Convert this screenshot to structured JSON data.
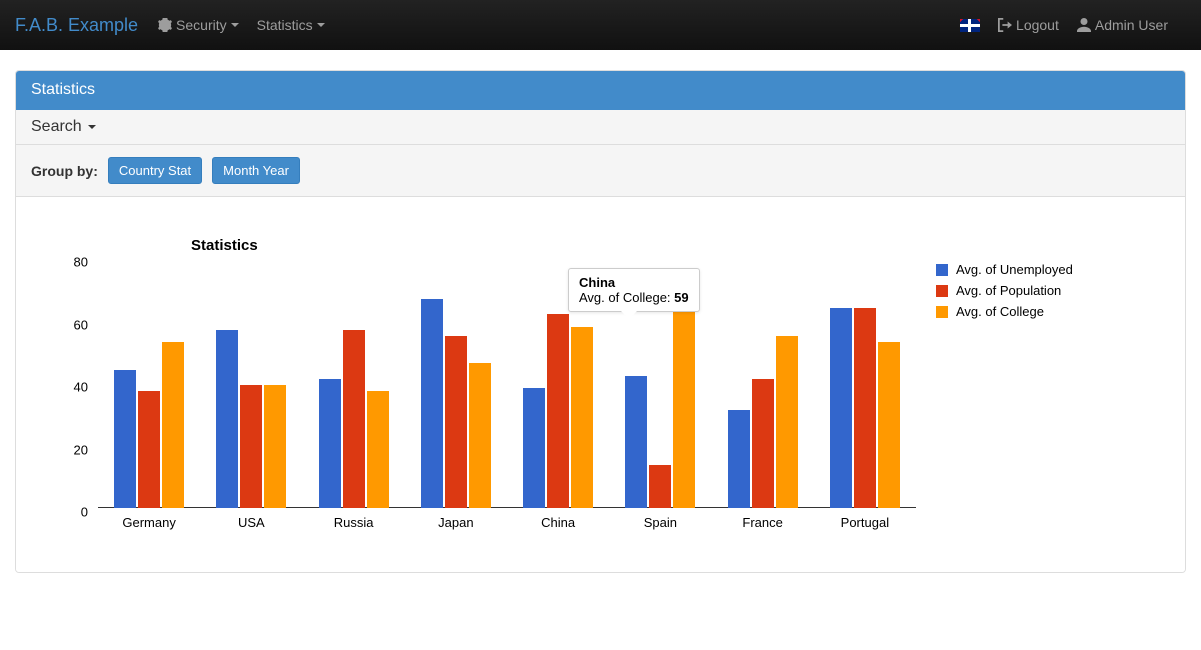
{
  "navbar": {
    "brand": "F.A.B. Example",
    "security": "Security",
    "statistics": "Statistics",
    "logout": "Logout",
    "user": "Admin User"
  },
  "panel": {
    "title": "Statistics",
    "search_label": "Search",
    "groupby_label": "Group by:",
    "group_buttons": [
      "Country Stat",
      "Month Year"
    ]
  },
  "tooltip": {
    "category": "China",
    "series_label": "Avg. of College:",
    "value": "59"
  },
  "chart_data": {
    "type": "bar",
    "title": "Statistics",
    "ylabel": "",
    "xlabel": "",
    "ylim": [
      0,
      80
    ],
    "yticks": [
      0,
      20,
      40,
      60,
      80
    ],
    "categories": [
      "Germany",
      "USA",
      "Russia",
      "Japan",
      "China",
      "Spain",
      "France",
      "Portugal"
    ],
    "series": [
      {
        "name": "Avg. of Unemployed",
        "color": "#3366cc",
        "values": [
          45,
          58,
          42,
          68,
          39,
          43,
          32,
          65
        ]
      },
      {
        "name": "Avg. of Population",
        "color": "#dc3912",
        "values": [
          38,
          40,
          58,
          56,
          63,
          14,
          42,
          65
        ]
      },
      {
        "name": "Avg. of College",
        "color": "#ff9900",
        "values": [
          54,
          40,
          38,
          47,
          59,
          67,
          56,
          54
        ]
      }
    ]
  }
}
